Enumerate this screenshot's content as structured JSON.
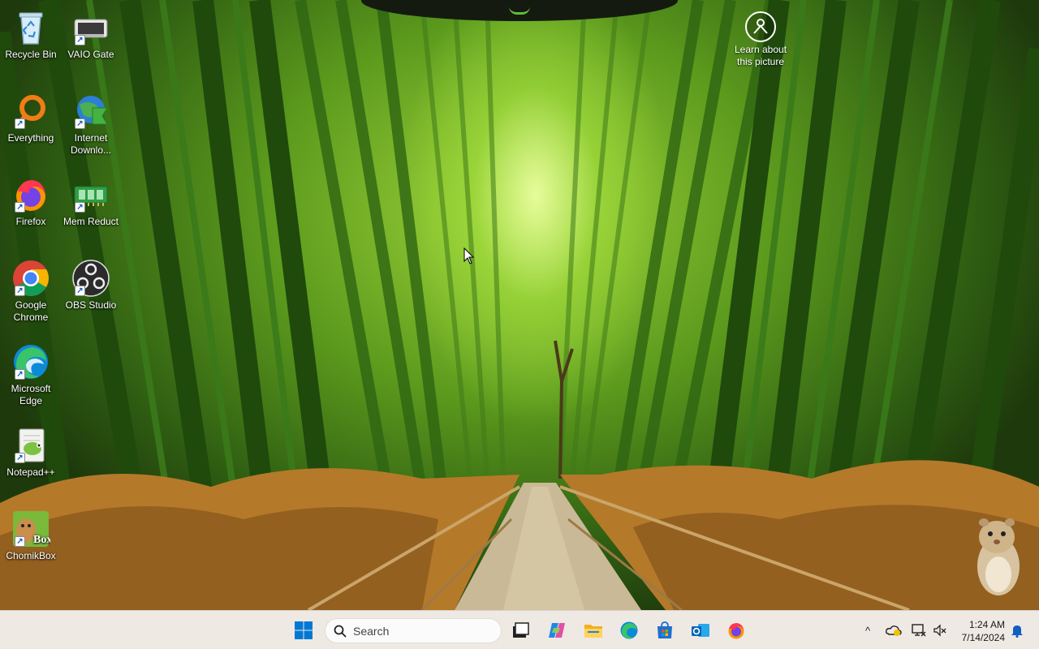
{
  "desktop": {
    "icons": [
      {
        "label": "Recycle Bin",
        "icon": "recycle-bin-icon"
      },
      {
        "label": "VAIO Gate",
        "icon": "vaio-gate-icon"
      },
      {
        "label": "Everything",
        "icon": "everything-icon"
      },
      {
        "label": "Internet Downlo...",
        "icon": "internet-download-manager-icon"
      },
      {
        "label": "Firefox",
        "icon": "firefox-icon"
      },
      {
        "label": "Mem Reduct",
        "icon": "mem-reduct-icon"
      },
      {
        "label": "Google Chrome",
        "icon": "chrome-icon"
      },
      {
        "label": "OBS Studio",
        "icon": "obs-studio-icon"
      },
      {
        "label": "Microsoft Edge",
        "icon": "edge-icon"
      },
      {
        "label": "Notepad++",
        "icon": "notepad-plus-plus-icon"
      },
      {
        "label": "ChomikBox",
        "icon": "chomikbox-icon"
      }
    ],
    "learn_about_picture": "Learn about this picture",
    "chomikbox_badge": "Box"
  },
  "taskbar": {
    "search_placeholder": "Search",
    "pinned": [
      "start-icon",
      "task-view-icon",
      "copilot-icon",
      "file-explorer-icon",
      "edge-icon",
      "microsoft-store-icon",
      "outlook-icon",
      "firefox-icon"
    ],
    "tray": {
      "chevron": "^",
      "time": "1:24 AM",
      "date": "7/14/2024"
    }
  },
  "colors": {
    "taskbar_bg": "#efe9e3",
    "windows_blue": "#0078d4",
    "bamboo_green": "#5c9a1d"
  }
}
